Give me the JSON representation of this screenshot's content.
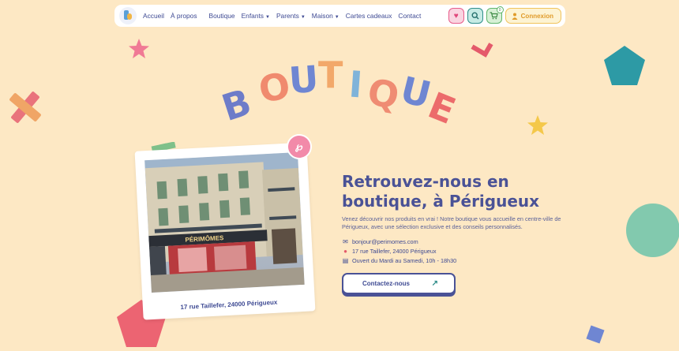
{
  "nav": {
    "links": [
      "Accueil",
      "À propos",
      "Boutique",
      "Enfants",
      "Parents",
      "Maison",
      "Cartes cadeaux",
      "Contact"
    ],
    "login_label": "Connexion",
    "cart_count": "0"
  },
  "title_letters": [
    "B",
    "O",
    "U",
    "T",
    "I",
    "Q",
    "U",
    "E"
  ],
  "content": {
    "heading_line1": "Retrouvez-nous en",
    "heading_line2": "boutique, à Périgueux",
    "description": "Venez découvrir nos produits en vrai ! Notre boutique vous accueille en centre-ville de Périgueux, avec une sélection exclusive et des conseils personnalisés.",
    "email": "bonjour@perimomes.com",
    "address": "17 rue Taillefer, 24000 Périgueux",
    "hours": "Ouvert du Mardi au Samedi, 10h - 18h30",
    "cta_label": "Contactez-nous"
  },
  "photo": {
    "caption": "17 rue Taillefer, 24000 Périgueux",
    "shop_sign": "PÉRIMÔMES"
  },
  "colors": {
    "background": "#fde8c4",
    "primary": "#4a5296",
    "pink": "#f28aa9",
    "teal": "#2f8e8a",
    "yellow": "#f0c35a"
  }
}
